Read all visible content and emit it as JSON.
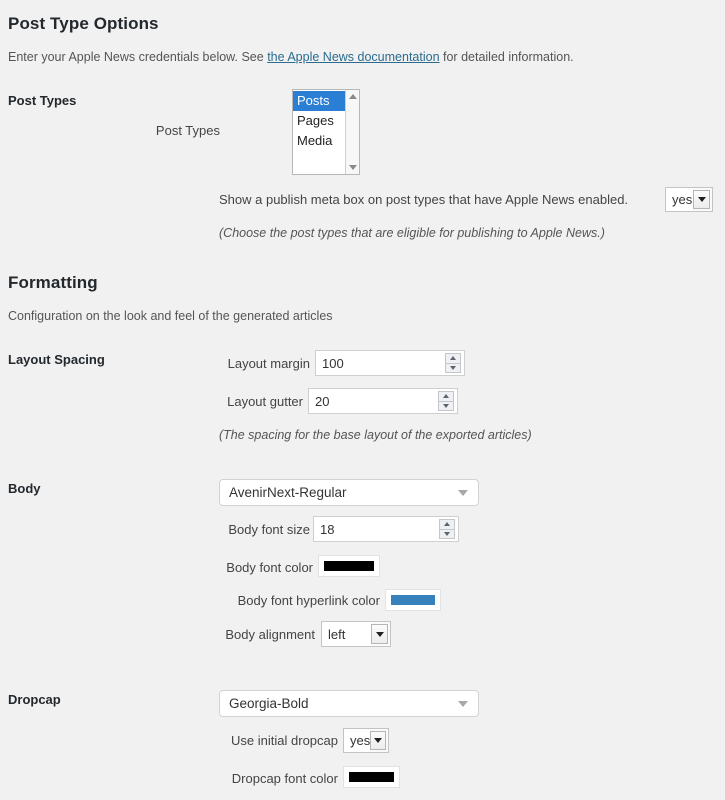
{
  "post_type_options": {
    "heading": "Post Type Options",
    "description_before": "Enter your Apple News credentials below. See ",
    "description_link": "the Apple News documentation",
    "description_after": " for detailed information.",
    "row_label": "Post Types",
    "post_types_field_label": "Post Types",
    "post_types_options": [
      "Posts",
      "Pages",
      "Media"
    ],
    "post_types_selected": "Posts",
    "meta_box_label": "Show a publish meta box on post types that have Apple News enabled.",
    "meta_box_value": "yes",
    "note": "(Choose the post types that are eligible for publishing to Apple News.)"
  },
  "formatting": {
    "heading": "Formatting",
    "description": "Configuration on the look and feel of the generated articles",
    "layout_spacing": {
      "row_label": "Layout Spacing",
      "margin_label": "Layout margin",
      "margin_value": "100",
      "gutter_label": "Layout gutter",
      "gutter_value": "20",
      "note": "(The spacing for the base layout of the exported articles)"
    },
    "body": {
      "row_label": "Body",
      "font_value": "AvenirNext-Regular",
      "font_size_label": "Body font size",
      "font_size_value": "18",
      "font_color_label": "Body font color",
      "font_color_value": "#000000",
      "hyperlink_color_label": "Body font hyperlink color",
      "hyperlink_color_value": "#3782bd",
      "alignment_label": "Body alignment",
      "alignment_value": "left"
    },
    "dropcap": {
      "row_label": "Dropcap",
      "font_value": "Georgia-Bold",
      "use_dropcap_label": "Use initial dropcap",
      "use_dropcap_value": "yes",
      "font_color_label": "Dropcap font color",
      "font_color_value": "#000000"
    }
  }
}
